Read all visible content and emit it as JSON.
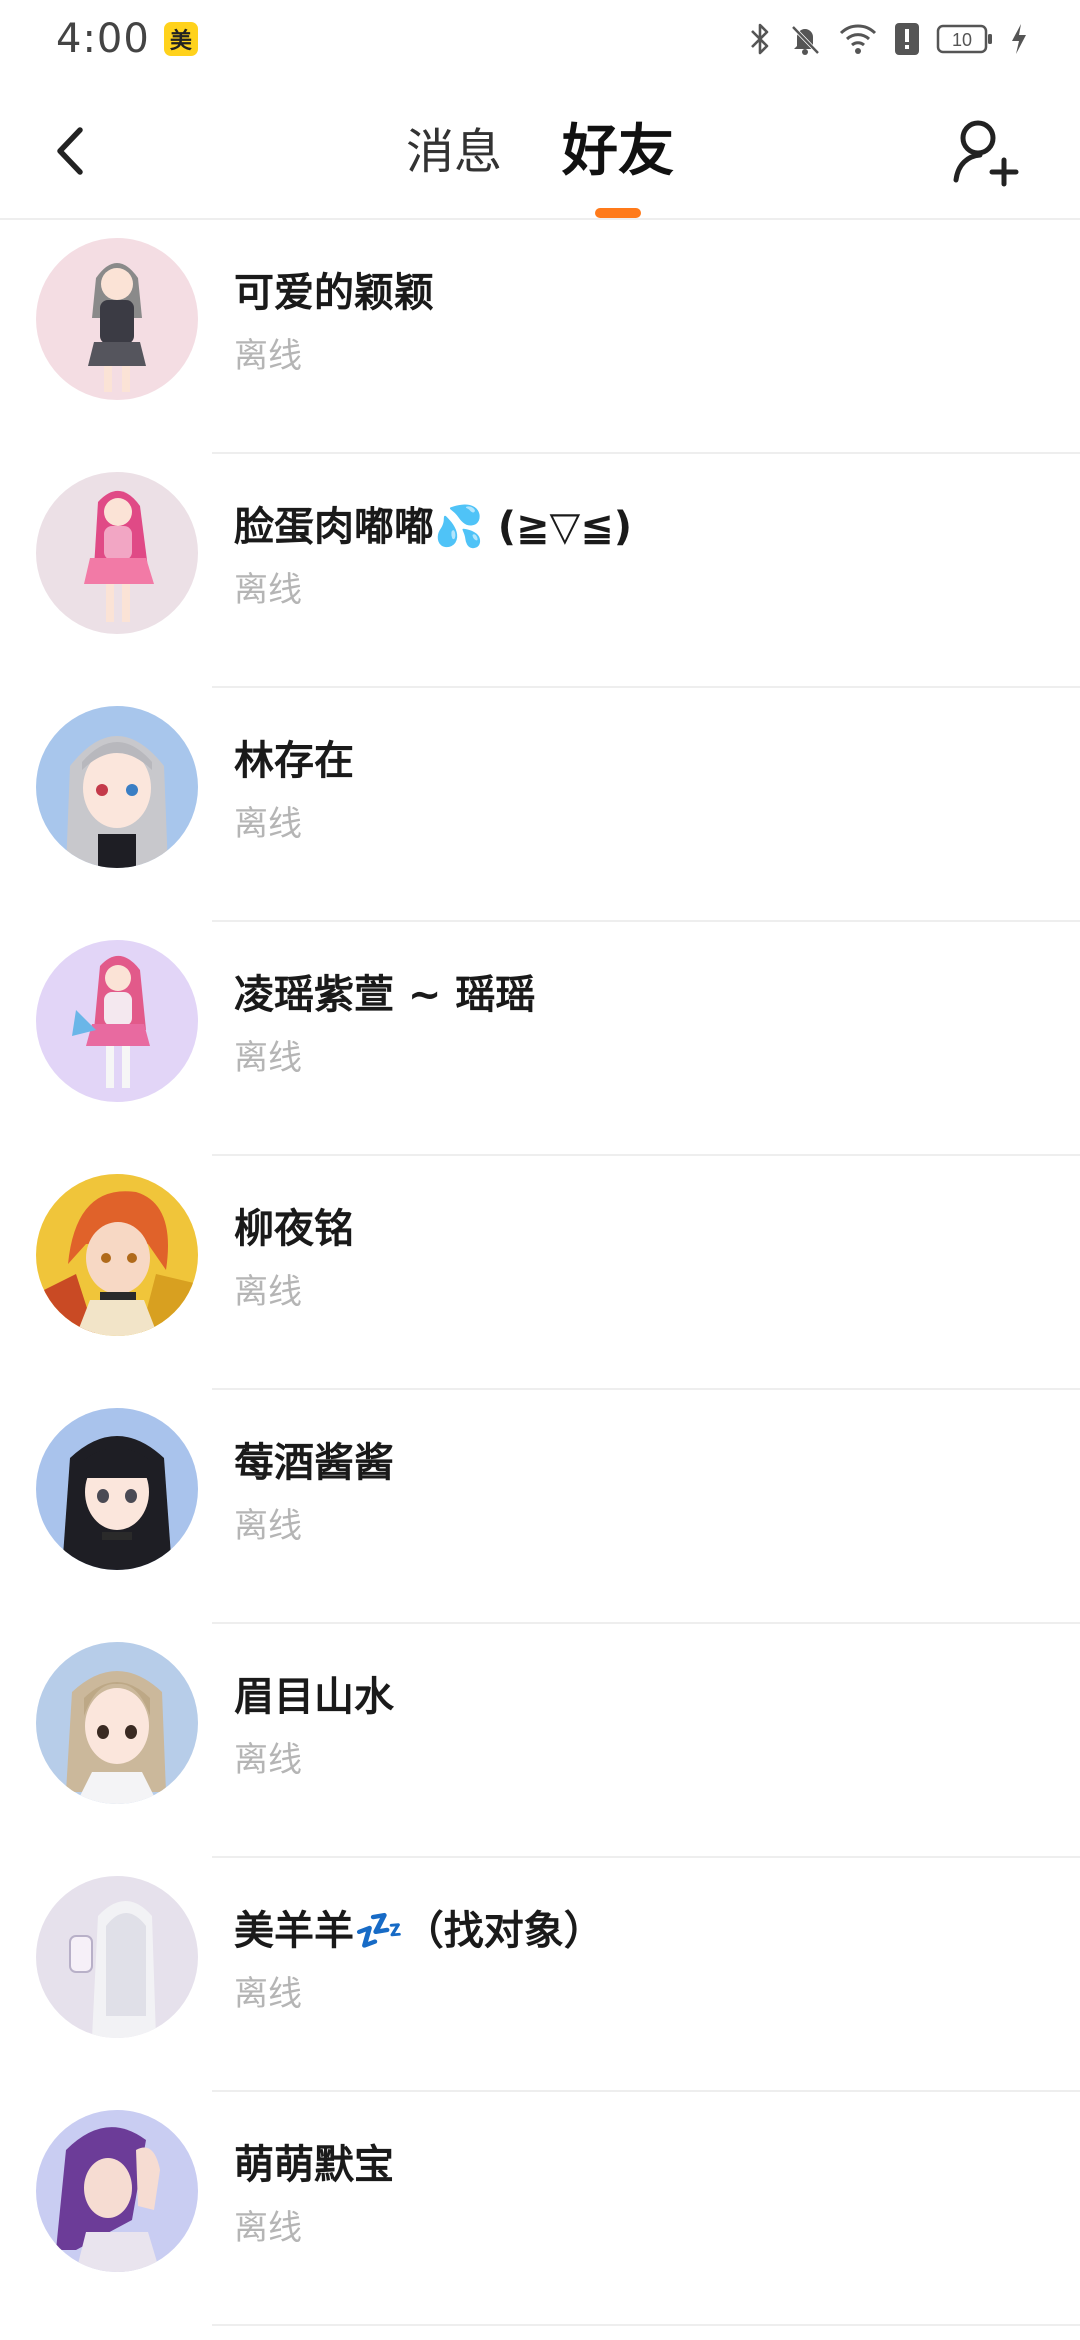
{
  "status_bar": {
    "time": "4:00",
    "badge": "美",
    "battery": "10",
    "icons": [
      "bluetooth-icon",
      "bell-off-icon",
      "wifi-icon",
      "alert-icon",
      "battery-icon",
      "charging-icon"
    ]
  },
  "header": {
    "tabs": [
      {
        "label": "消息",
        "active": false
      },
      {
        "label": "好友",
        "active": true
      }
    ],
    "accent_color": "#ff7a1a"
  },
  "friends": [
    {
      "name": "可爱的颖颖",
      "status": "离线",
      "avatar_bg": "#f4dde3",
      "hair": "#8a8a8a"
    },
    {
      "name": "脸蛋肉嘟嘟💦 (≧▽≦)",
      "status": "离线",
      "avatar_bg": "#ece0e6",
      "hair": "#e04a86"
    },
    {
      "name": "林存在",
      "status": "离线",
      "avatar_bg": "#a8c6ec",
      "hair": "#c8c8cc"
    },
    {
      "name": "凌瑶紫萱 ~ 瑶瑶",
      "status": "离线",
      "avatar_bg": "#e2d5f7",
      "hair": "#e25a8a"
    },
    {
      "name": "柳夜铭",
      "status": "离线",
      "avatar_bg": "#f0c53a",
      "hair": "#e0622a"
    },
    {
      "name": "莓酒酱酱",
      "status": "离线",
      "avatar_bg": "#a9c3ec",
      "hair": "#1e1e24"
    },
    {
      "name": "眉目山水",
      "status": "离线",
      "avatar_bg": "#b7cde9",
      "hair": "#cbb89b"
    },
    {
      "name": "美羊羊💤（找对象）",
      "status": "离线",
      "avatar_bg": "#e6e1ec",
      "hair": "#f2f2f5"
    },
    {
      "name": "萌萌默宝",
      "status": "离线",
      "avatar_bg": "#c9cdf2",
      "hair": "#6c3c98"
    }
  ]
}
